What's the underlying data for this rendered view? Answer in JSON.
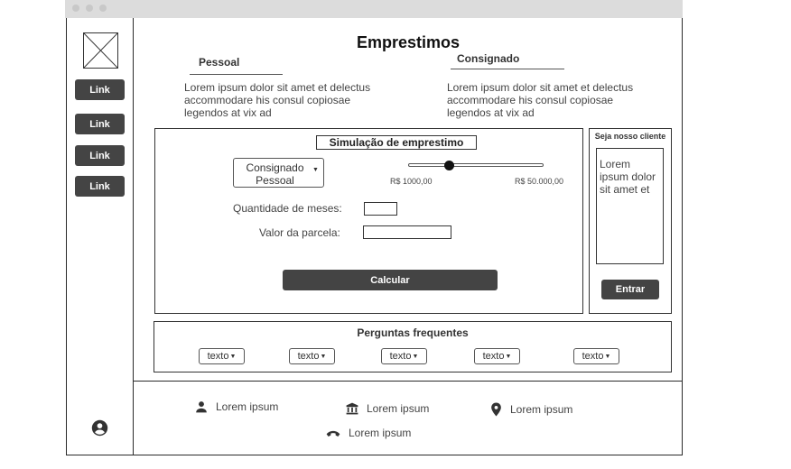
{
  "window": {
    "controls": [
      "dot",
      "dot",
      "dot"
    ]
  },
  "sidebar": {
    "logo_icon": "image-placeholder-icon",
    "links": [
      {
        "label": "Link"
      },
      {
        "label": "Link"
      },
      {
        "label": "Link"
      },
      {
        "label": "Link"
      }
    ],
    "user_icon": "account-circle-icon"
  },
  "header": {
    "title": "Emprestimos",
    "columns": [
      {
        "title": "Pessoal",
        "text": "Lorem ipsum dolor sit amet et delectus accommodare his consul copiosae legendos at vix ad"
      },
      {
        "title": "Consignado",
        "text": "Lorem ipsum dolor sit amet et delectus accommodare his consul copiosae legendos at vix ad"
      }
    ]
  },
  "simulation": {
    "title": "Simulação de emprestimo",
    "loan_type": {
      "selected": "Consignado Pessoal"
    },
    "slider": {
      "min_label": "R$ 1000,00",
      "max_label": "R$ 50.000,00",
      "position": 0.3
    },
    "months_label": "Quantidade de meses:",
    "months_value": "",
    "installment_label": "Valor da parcela:",
    "installment_value": "",
    "calculate_label": "Calcular"
  },
  "client_panel": {
    "title": "Seja nosso cliente",
    "text": "Lorem ipsum dolor sit amet et",
    "enter_label": "Entrar"
  },
  "faq": {
    "title": "Perguntas frequentes",
    "items": [
      {
        "label": "texto"
      },
      {
        "label": "texto"
      },
      {
        "label": "texto"
      },
      {
        "label": "texto"
      },
      {
        "label": "texto"
      }
    ]
  },
  "footer": {
    "items": [
      {
        "icon": "person-icon",
        "text": "Lorem ipsum"
      },
      {
        "icon": "bank-icon",
        "text": "Lorem ipsum"
      },
      {
        "icon": "location-pin-icon",
        "text": "Lorem ipsum"
      },
      {
        "icon": "phone-icon",
        "text": "Lorem ipsum"
      }
    ]
  },
  "colors": {
    "button_bg": "#444444",
    "border": "#333333",
    "titlebar": "#dcdcdc"
  }
}
